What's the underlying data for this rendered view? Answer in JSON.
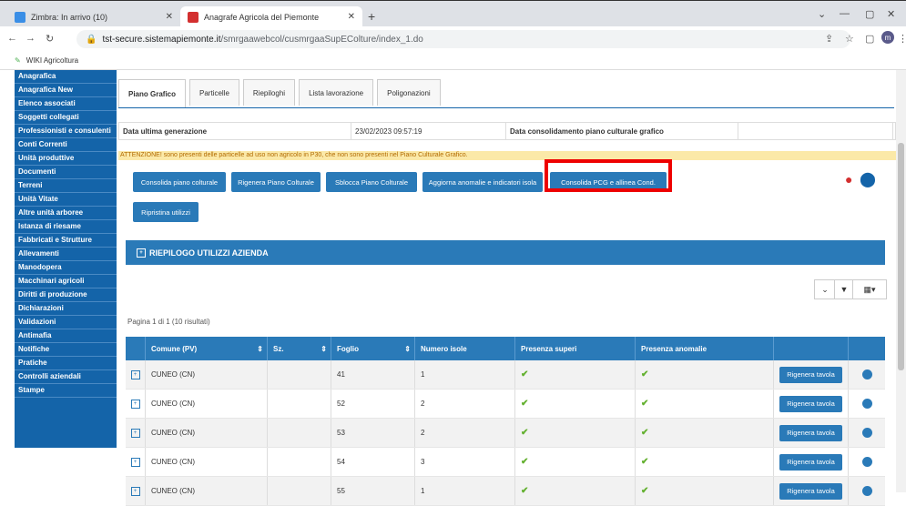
{
  "browser": {
    "tabs": [
      {
        "title": "Zimbra: In arrivo (10)"
      },
      {
        "title": "Anagrafe Agricola del Piemonte"
      }
    ],
    "url_host": "tst-secure.sistemapiemonte.it",
    "url_path": "/smrgaawebcol/cusmrgaaSupEColture/index_1.do",
    "bookmark": "WIKI Agricoltura",
    "avatar_letter": "m"
  },
  "sidebar": {
    "items": [
      "Anagrafica",
      "Anagrafica New",
      "Elenco associati",
      "Soggetti collegati",
      "Professionisti e consulenti",
      "Conti Correnti",
      "Unità produttive",
      "Documenti",
      "Terreni",
      "Unità Vitate",
      "Altre unità arboree",
      "Istanza di riesame",
      "Fabbricati e Strutture",
      "Allevamenti",
      "Manodopera",
      "Macchinari agricoli",
      "Diritti di produzione",
      "Dichiarazioni",
      "Validazioni",
      "Antimafia",
      "Notifiche",
      "Pratiche",
      "Controlli aziendali",
      "Stampe"
    ]
  },
  "page_tabs": [
    "Piano Grafico",
    "Particelle",
    "Riepiloghi",
    "Lista lavorazione",
    "Poligonazioni"
  ],
  "info": {
    "label1": "Data ultima generazione",
    "value1": "23/02/2023 09:57:19",
    "label2": "Data consolidamento piano culturale grafico",
    "value2": ""
  },
  "warning": "ATTENZIONE! sono presenti delle particelle ad uso non agricolo in P30, che non sono presenti nel Piano Culturale Grafico.",
  "actions": [
    "Consolida piano colturale",
    "Rigenera Piano Colturale",
    "Sblocca Piano Colturale",
    "Aggiorna anomalie e indicatori isola",
    "Consolida PCG e allinea Cond."
  ],
  "restore_button": "Ripristina utilizzi",
  "panel_title": "RIEPILOGO UTILIZZI AZIENDA",
  "pager": "Pagina 1 di 1 (10 risultati)",
  "table": {
    "headers": [
      "Comune (PV)",
      "Sz.",
      "Foglio",
      "Numero isole",
      "Presenza superi",
      "Presenza anomalie"
    ],
    "rows": [
      {
        "comune": "CUNEO (CN)",
        "sz": "",
        "foglio": "41",
        "isole": "1"
      },
      {
        "comune": "CUNEO (CN)",
        "sz": "",
        "foglio": "52",
        "isole": "2"
      },
      {
        "comune": "CUNEO (CN)",
        "sz": "",
        "foglio": "53",
        "isole": "2"
      },
      {
        "comune": "CUNEO (CN)",
        "sz": "",
        "foglio": "54",
        "isole": "3"
      },
      {
        "comune": "CUNEO (CN)",
        "sz": "",
        "foglio": "55",
        "isole": "1"
      }
    ],
    "row_button": "Rigenera tavola"
  }
}
